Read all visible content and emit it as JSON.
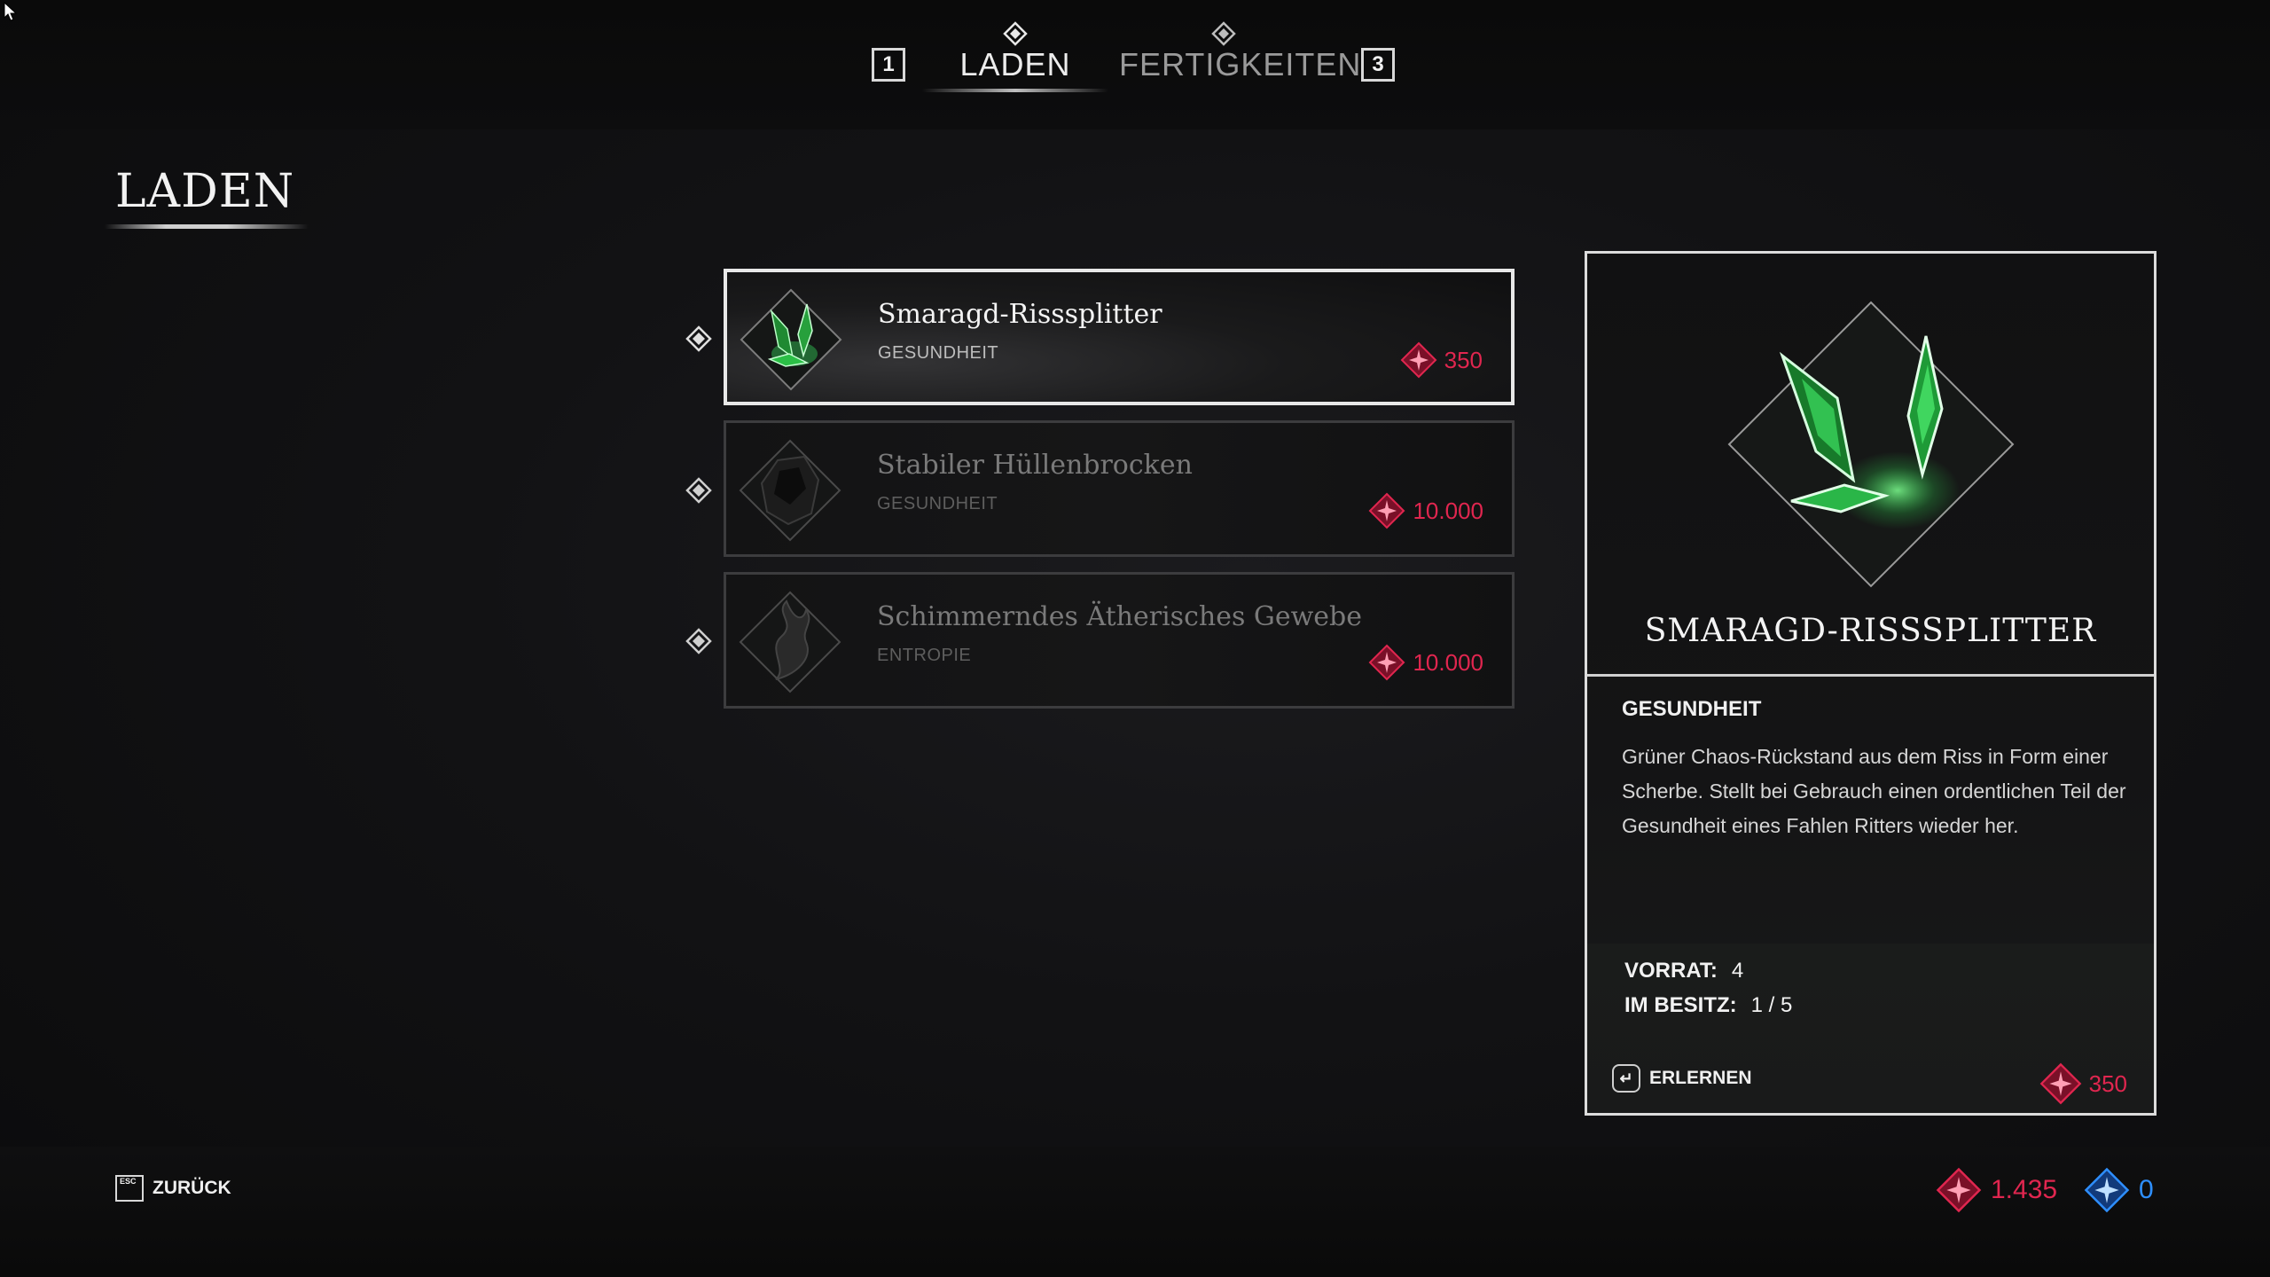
{
  "top_nav": {
    "left_key": "1",
    "right_key": "3",
    "tabs": [
      {
        "label": "LADEN",
        "active": true
      },
      {
        "label": "FERTIGKEITEN",
        "active": false
      }
    ]
  },
  "page": {
    "title": "LADEN"
  },
  "shop_items": [
    {
      "name": "Smaragd-Risssplitter",
      "category": "GESUNDHEIT",
      "price": "350",
      "selected": true,
      "icon": "emerald-shard-icon"
    },
    {
      "name": "Stabiler Hüllenbrocken",
      "category": "GESUNDHEIT",
      "price": "10.000",
      "selected": false,
      "icon": "dark-rock-icon"
    },
    {
      "name": "Schimmerndes Ätherisches Gewebe",
      "category": "ENTROPIE",
      "price": "10.000",
      "selected": false,
      "icon": "ether-wisp-icon"
    }
  ],
  "detail": {
    "name": "SMARAGD-RISSSPLITTER",
    "category": "GESUNDHEIT",
    "description": "Grüner Chaos-Rückstand aus dem Riss in Form einer Scherbe. Stellt bei Gebrauch einen ordentlichen Teil der Gesundheit eines Fahlen Ritters wieder her.",
    "stock_label": "VORRAT:",
    "stock_value": "4",
    "owned_label": "IM BESITZ:",
    "owned_value": "1 / 5",
    "action_label": "ERLERNEN",
    "action_key_icon": "enter-key-icon",
    "price": "350"
  },
  "footer": {
    "back_key": "ESC",
    "back_label": "ZURÜCK",
    "currency_red": "1.435",
    "currency_blue": "0"
  },
  "colors": {
    "price_red": "#e0264f",
    "currency_blue": "#2e8fff",
    "emerald": "#3dff6a",
    "panel_border": "#dcdcdc"
  }
}
